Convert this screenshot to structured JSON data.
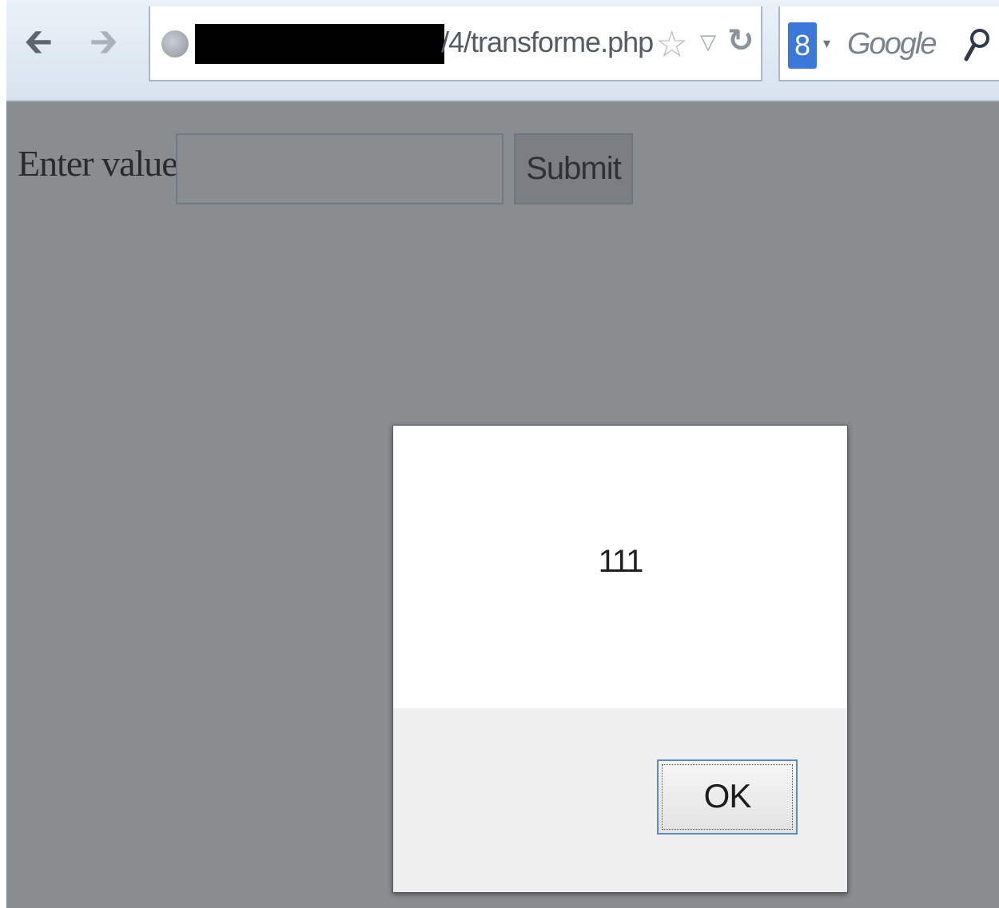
{
  "browser": {
    "url_visible": "/4/transforme.php",
    "search_engine_placeholder": "Google",
    "search_engine_icon_letter": "8"
  },
  "page": {
    "form": {
      "label": "Enter value:",
      "input_value": "",
      "submit_label": "Submit"
    }
  },
  "alert": {
    "message": "111",
    "ok_label": "OK"
  },
  "colors": {
    "page_background": "#8a8d90",
    "toolbar_background": "#dce6f0",
    "dialog_background": "#ffffff",
    "dialog_footer": "#efefef",
    "ok_border": "#5b8bbf"
  },
  "icons": {
    "back": "back-arrow-icon",
    "forward": "forward-arrow-icon",
    "site": "globe-icon",
    "bookmark": "star-icon",
    "history_dropdown": "dropdown-triangle-icon",
    "reload": "reload-icon",
    "search_engine": "search-engine-icon",
    "search": "magnifier-icon"
  }
}
